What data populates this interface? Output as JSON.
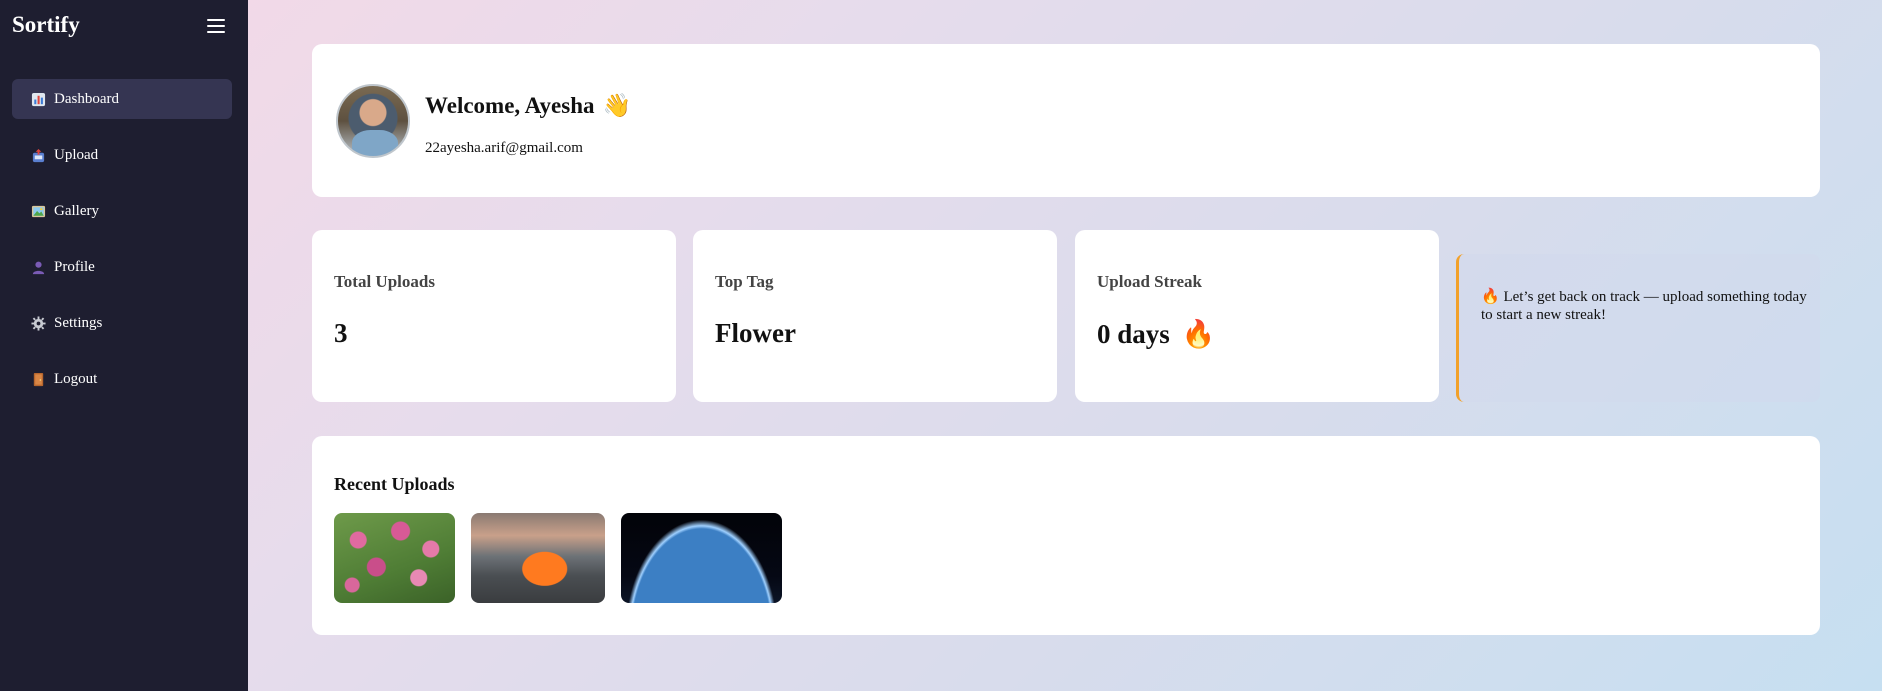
{
  "sidebar": {
    "brand": "Sortify",
    "items": [
      {
        "label": "Dashboard",
        "icon": "bar-chart-icon",
        "active": true
      },
      {
        "label": "Upload",
        "icon": "inbox-tray-icon",
        "active": false
      },
      {
        "label": "Gallery",
        "icon": "picture-icon",
        "active": false
      },
      {
        "label": "Profile",
        "icon": "user-icon",
        "active": false
      },
      {
        "label": "Settings",
        "icon": "gear-icon",
        "active": false
      },
      {
        "label": "Logout",
        "icon": "door-icon",
        "active": false
      }
    ]
  },
  "welcome": {
    "title": "Welcome, Ayesha",
    "emoji": "👋",
    "email": "22ayesha.arif@gmail.com"
  },
  "stats": {
    "total_uploads": {
      "label": "Total Uploads",
      "value": "3"
    },
    "top_tag": {
      "label": "Top Tag",
      "value": "Flower"
    },
    "upload_streak": {
      "label": "Upload Streak",
      "value": "0 days",
      "emoji": "🔥"
    }
  },
  "streak_note": {
    "emoji": "🔥",
    "message": "Let’s get back on track — upload something today to start a new streak!"
  },
  "recent": {
    "title": "Recent Uploads",
    "items": [
      {
        "subject": "pink flowers"
      },
      {
        "subject": "orange sports car"
      },
      {
        "subject": "earth from space"
      }
    ]
  },
  "colors": {
    "sidebar_bg": "#1e1e30",
    "active_item_bg": "#353552",
    "streak_accent": "#f2a12a"
  }
}
